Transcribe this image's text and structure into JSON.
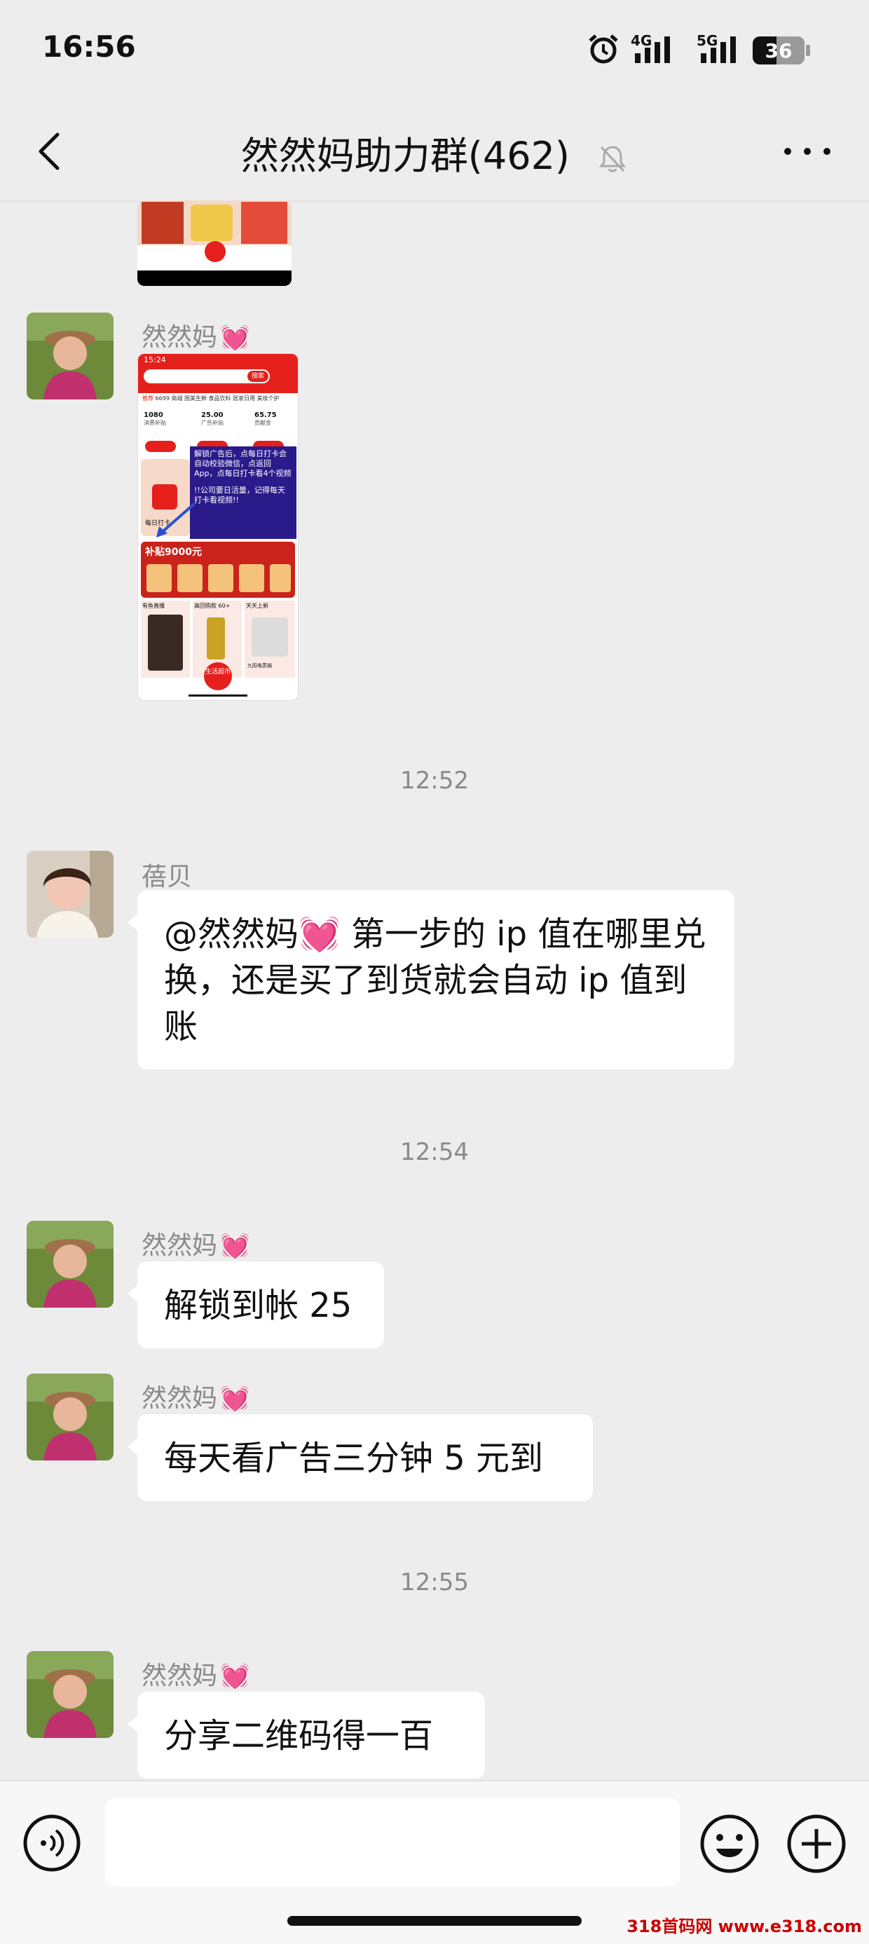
{
  "status_bar": {
    "time": "16:56",
    "network_1": "4G",
    "network_2": "5G",
    "battery": "36"
  },
  "header": {
    "title": "然然妈助力群(462)",
    "back_icon": "chevron-left-icon",
    "mute_icon": "bell-off-icon",
    "more_icon": "more-dots-icon"
  },
  "messages": [
    {
      "type": "image",
      "sender": "",
      "continuation": true
    },
    {
      "type": "image",
      "sender": "然然妈",
      "screenshot": {
        "time": "15:24",
        "search_button": "搜索",
        "tabs": [
          "推荐",
          "6699 商城",
          "国美生鲜",
          "食品饮料",
          "居家日用",
          "美妆个护"
        ],
        "stats": [
          {
            "value": "1080",
            "label": "消费补贴"
          },
          {
            "value": "25.00",
            "label": "广告补贴"
          },
          {
            "value": "65.75",
            "label": "贡献金"
          }
        ],
        "overlay_text_1": "解锁广告后，点每日打卡会自动校验微信，点返回App，点每日打卡看4个视频",
        "overlay_text_2": "!!公司要日活量，记得每天打卡看视频!!",
        "checkin_label": "每日打卡",
        "banner": "补贴9000元",
        "section_1": "有鱼直播",
        "section_2": "高回购款 60+",
        "section_3": "天天上新",
        "product_label": "九阳电蒸锅",
        "center_badge": "生活超市"
      }
    },
    {
      "type": "time",
      "text": "12:52"
    },
    {
      "type": "text",
      "sender": "蓓贝",
      "text": "@然然妈💓 第一步的 ip 值在哪里兑换，还是买了到货就会自动 ip 值到账"
    },
    {
      "type": "time",
      "text": "12:54"
    },
    {
      "type": "text",
      "sender": "然然妈",
      "text": "解锁到帐 25"
    },
    {
      "type": "text",
      "sender": "然然妈",
      "text": "每天看广告三分钟 5 元到"
    },
    {
      "type": "time",
      "text": "12:55"
    },
    {
      "type": "text",
      "sender": "然然妈",
      "text": "分享二维码得一百"
    }
  ],
  "sender_badge": "💓",
  "input_bar": {
    "voice_icon": "voice-icon",
    "emoji_icon": "emoji-icon",
    "add_icon": "plus-circle-icon",
    "placeholder": ""
  },
  "watermark": "318首码网 www.e318.com",
  "colors": {
    "background": "#ededed",
    "bubble": "#ffffff",
    "accent_red": "#e5201c",
    "overlay_blue": "#2a1a8a"
  }
}
